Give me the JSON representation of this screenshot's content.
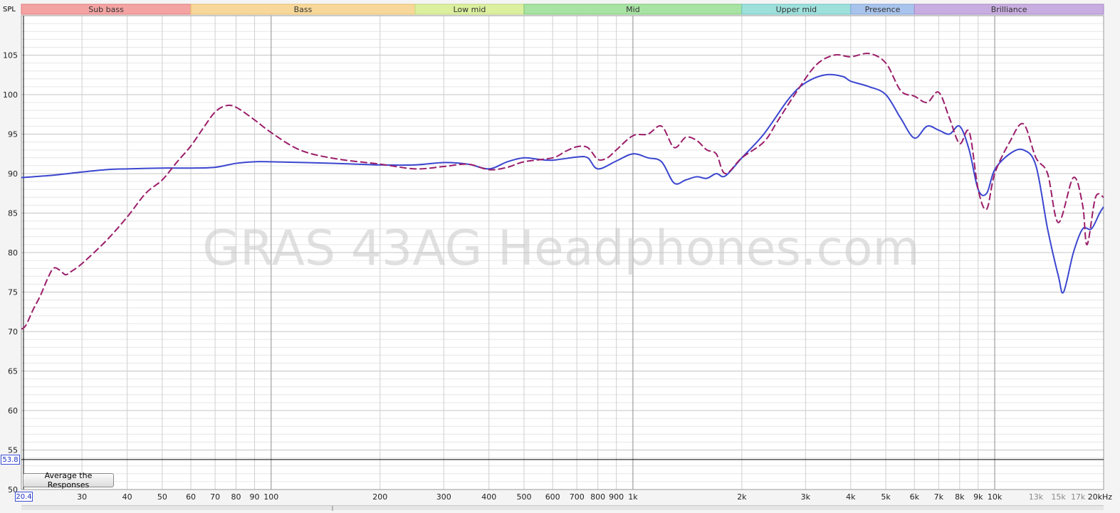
{
  "bands": [
    {
      "label": "Sub bass",
      "from": 20,
      "to": 60,
      "fill": "#f4a3a3",
      "stroke": "#e27a7a"
    },
    {
      "label": "Bass",
      "from": 60,
      "to": 250,
      "fill": "#f8d89a",
      "stroke": "#e6bb6a"
    },
    {
      "label": "Low mid",
      "from": 250,
      "to": 500,
      "fill": "#dcef9f",
      "stroke": "#bcd87a"
    },
    {
      "label": "Mid",
      "from": 500,
      "to": 2000,
      "fill": "#a8e3a4",
      "stroke": "#7cc778"
    },
    {
      "label": "Upper mid",
      "from": 2000,
      "to": 4000,
      "fill": "#9ee0dc",
      "stroke": "#6cc4bf"
    },
    {
      "label": "Presence",
      "from": 4000,
      "to": 6000,
      "fill": "#a9c4ec",
      "stroke": "#7fa3d8"
    },
    {
      "label": "Brilliance",
      "from": 6000,
      "to": 20000,
      "fill": "#c8aee0",
      "stroke": "#a887c9"
    }
  ],
  "axis": {
    "y_title": "SPL",
    "y_marker": "53.8",
    "x_marker": "20.4",
    "x_unit": "kHz"
  },
  "watermark": "GRAS 43AG Headphones.com",
  "button_label": "Average the Responses",
  "chart_data": {
    "type": "line",
    "xscale": "log",
    "xlim": [
      20.4,
      20000
    ],
    "ylim": [
      50,
      110
    ],
    "grid": true,
    "reference_level": 53.8,
    "y_ticks": [
      50,
      55,
      60,
      65,
      70,
      75,
      80,
      85,
      90,
      95,
      100,
      105
    ],
    "x_ticks": [
      {
        "v": 30,
        "label": "30"
      },
      {
        "v": 40,
        "label": "40"
      },
      {
        "v": 50,
        "label": "50"
      },
      {
        "v": 60,
        "label": "60"
      },
      {
        "v": 70,
        "label": "70"
      },
      {
        "v": 80,
        "label": "80"
      },
      {
        "v": 90,
        "label": "90"
      },
      {
        "v": 100,
        "label": "100"
      },
      {
        "v": 200,
        "label": "200"
      },
      {
        "v": 300,
        "label": "300"
      },
      {
        "v": 400,
        "label": "400"
      },
      {
        "v": 500,
        "label": "500"
      },
      {
        "v": 600,
        "label": "600"
      },
      {
        "v": 700,
        "label": "700"
      },
      {
        "v": 800,
        "label": "800"
      },
      {
        "v": 900,
        "label": "900"
      },
      {
        "v": 1000,
        "label": "1k"
      },
      {
        "v": 2000,
        "label": "2k"
      },
      {
        "v": 3000,
        "label": "3k"
      },
      {
        "v": 4000,
        "label": "4k"
      },
      {
        "v": 5000,
        "label": "5k"
      },
      {
        "v": 6000,
        "label": "6k"
      },
      {
        "v": 7000,
        "label": "7k"
      },
      {
        "v": 8000,
        "label": "8k"
      },
      {
        "v": 9000,
        "label": "9k"
      },
      {
        "v": 10000,
        "label": "10k"
      },
      {
        "v": 13000,
        "label": "13k",
        "muted": true
      },
      {
        "v": 15000,
        "label": "15k",
        "muted": true
      },
      {
        "v": 17000,
        "label": "17k",
        "muted": true
      },
      {
        "v": 20000,
        "label": "20kHz"
      }
    ],
    "series": [
      {
        "color": "#3b46cf",
        "dash": "solid",
        "points": [
          [
            20.4,
            89.5
          ],
          [
            25,
            89.8
          ],
          [
            30,
            90.2
          ],
          [
            35,
            90.5
          ],
          [
            40,
            90.6
          ],
          [
            50,
            90.7
          ],
          [
            60,
            90.7
          ],
          [
            70,
            90.8
          ],
          [
            80,
            91.3
          ],
          [
            90,
            91.5
          ],
          [
            100,
            91.5
          ],
          [
            150,
            91.3
          ],
          [
            200,
            91.1
          ],
          [
            250,
            91.1
          ],
          [
            300,
            91.4
          ],
          [
            350,
            91.2
          ],
          [
            400,
            90.6
          ],
          [
            450,
            91.5
          ],
          [
            500,
            92.0
          ],
          [
            550,
            91.8
          ],
          [
            600,
            91.7
          ],
          [
            700,
            92.1
          ],
          [
            750,
            92.0
          ],
          [
            800,
            90.6
          ],
          [
            900,
            91.6
          ],
          [
            1000,
            92.5
          ],
          [
            1100,
            92.0
          ],
          [
            1200,
            91.5
          ],
          [
            1300,
            88.8
          ],
          [
            1400,
            89.2
          ],
          [
            1500,
            89.6
          ],
          [
            1600,
            89.4
          ],
          [
            1700,
            90.0
          ],
          [
            1800,
            89.7
          ],
          [
            2000,
            92.0
          ],
          [
            2300,
            95.0
          ],
          [
            2700,
            99.5
          ],
          [
            3000,
            101.5
          ],
          [
            3400,
            102.5
          ],
          [
            3800,
            102.3
          ],
          [
            4000,
            101.7
          ],
          [
            4500,
            101.0
          ],
          [
            5000,
            100.0
          ],
          [
            5500,
            97.0
          ],
          [
            6000,
            94.5
          ],
          [
            6500,
            96.0
          ],
          [
            7000,
            95.5
          ],
          [
            7500,
            95.0
          ],
          [
            8000,
            96.0
          ],
          [
            8500,
            93.0
          ],
          [
            9000,
            88.0
          ],
          [
            9500,
            87.5
          ],
          [
            10000,
            90.5
          ],
          [
            11000,
            92.5
          ],
          [
            12000,
            93.0
          ],
          [
            13000,
            91.0
          ],
          [
            14000,
            83.0
          ],
          [
            15000,
            77.0
          ],
          [
            15500,
            75.0
          ],
          [
            16500,
            80.0
          ],
          [
            17500,
            83.0
          ],
          [
            18500,
            83.0
          ],
          [
            19500,
            85.0
          ],
          [
            20000,
            85.8
          ]
        ]
      },
      {
        "color": "#9b1d6a",
        "dash": "dashed",
        "points": [
          [
            20.4,
            70.3
          ],
          [
            21,
            70.8
          ],
          [
            22,
            72.8
          ],
          [
            23,
            74.5
          ],
          [
            24,
            76.5
          ],
          [
            25,
            78.0
          ],
          [
            26,
            77.8
          ],
          [
            27,
            77.2
          ],
          [
            28,
            77.6
          ],
          [
            30,
            78.6
          ],
          [
            35,
            81.5
          ],
          [
            40,
            84.5
          ],
          [
            45,
            87.5
          ],
          [
            50,
            89.2
          ],
          [
            55,
            91.5
          ],
          [
            60,
            93.5
          ],
          [
            65,
            95.8
          ],
          [
            70,
            97.8
          ],
          [
            75,
            98.6
          ],
          [
            80,
            98.4
          ],
          [
            90,
            96.8
          ],
          [
            100,
            95.2
          ],
          [
            120,
            93.0
          ],
          [
            150,
            91.9
          ],
          [
            200,
            91.2
          ],
          [
            250,
            90.6
          ],
          [
            300,
            90.9
          ],
          [
            350,
            91.2
          ],
          [
            400,
            90.5
          ],
          [
            450,
            90.8
          ],
          [
            500,
            91.5
          ],
          [
            600,
            92.0
          ],
          [
            650,
            92.8
          ],
          [
            700,
            93.4
          ],
          [
            750,
            93.3
          ],
          [
            800,
            91.8
          ],
          [
            850,
            92.0
          ],
          [
            900,
            93.0
          ],
          [
            1000,
            94.8
          ],
          [
            1100,
            95.0
          ],
          [
            1200,
            96.0
          ],
          [
            1300,
            93.3
          ],
          [
            1400,
            94.6
          ],
          [
            1500,
            94.2
          ],
          [
            1600,
            93.0
          ],
          [
            1700,
            92.5
          ],
          [
            1800,
            90.0
          ],
          [
            2000,
            92.0
          ],
          [
            2300,
            94.0
          ],
          [
            2500,
            96.5
          ],
          [
            2800,
            100.0
          ],
          [
            3200,
            103.7
          ],
          [
            3600,
            105.0
          ],
          [
            4000,
            104.8
          ],
          [
            4500,
            105.2
          ],
          [
            5000,
            104.0
          ],
          [
            5500,
            100.5
          ],
          [
            6000,
            99.8
          ],
          [
            6500,
            99.0
          ],
          [
            7000,
            100.3
          ],
          [
            7500,
            97.0
          ],
          [
            8000,
            93.8
          ],
          [
            8500,
            95.3
          ],
          [
            9000,
            88.0
          ],
          [
            9500,
            85.5
          ],
          [
            10000,
            90.0
          ],
          [
            11000,
            94.0
          ],
          [
            12000,
            96.3
          ],
          [
            13000,
            92.0
          ],
          [
            14000,
            90.0
          ],
          [
            15000,
            83.8
          ],
          [
            16500,
            89.5
          ],
          [
            17500,
            86.0
          ],
          [
            18000,
            81.0
          ],
          [
            19000,
            87.0
          ],
          [
            20000,
            87.0
          ]
        ]
      }
    ]
  }
}
